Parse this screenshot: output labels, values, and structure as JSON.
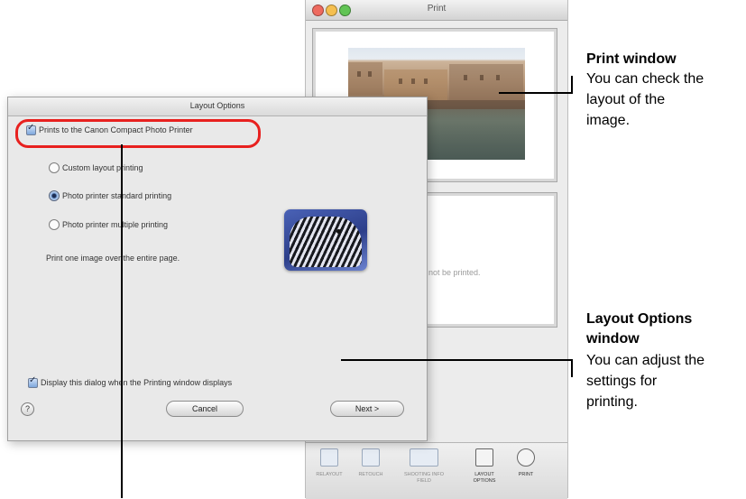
{
  "print_window": {
    "title": "Print",
    "page2_text": "will not be printed.",
    "toolbar": [
      {
        "label": "RELAYOUT",
        "icon": "relayout-icon"
      },
      {
        "label": "RETOUCH",
        "icon": "retouch-icon"
      },
      {
        "label": "SHOOTING INFO FIELD",
        "icon": "shooting-info-icon"
      },
      {
        "label": "LAYOUT OPTIONS",
        "icon": "layout-options-icon"
      },
      {
        "label": "PRINT",
        "icon": "print-icon"
      }
    ]
  },
  "layout_dialog": {
    "title": "Layout Options",
    "prints_to_checkbox": "Prints to the Canon Compact Photo Printer",
    "radio_options": [
      {
        "label": "Custom layout printing",
        "selected": false
      },
      {
        "label": "Photo printer standard printing",
        "selected": true
      },
      {
        "label": "Photo printer multiple printing",
        "selected": false
      }
    ],
    "description": "Print one image over the entire page.",
    "display_checkbox": "Display this dialog when the Printing window displays",
    "cancel_button": "Cancel",
    "next_button": "Next >",
    "help_button": "?"
  },
  "annotations": {
    "print_window_title": "Print window",
    "print_window_text": [
      "You can check the",
      "layout of the",
      "image."
    ],
    "layout_options_title": [
      "Layout Options",
      "window"
    ],
    "layout_options_text": [
      "You can adjust the",
      "settings for",
      "printing."
    ]
  },
  "colors": {
    "highlight": "#e8211f",
    "checkbox_blue": "#7ea7dc"
  }
}
